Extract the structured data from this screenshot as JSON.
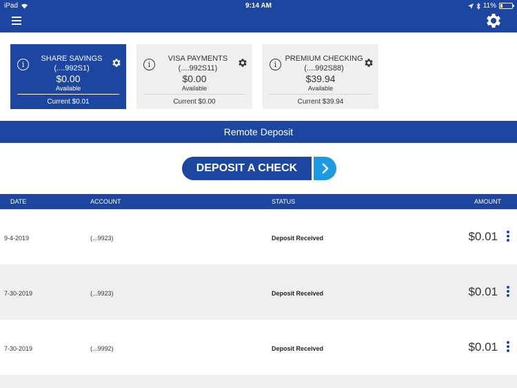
{
  "status_bar": {
    "device": "iPad",
    "time": "9:14 AM",
    "battery": "11%"
  },
  "header": {
    "menu_icon": "hamburger-icon",
    "settings_icon": "gear-icon"
  },
  "accounts": [
    {
      "name": "SHARE SAVINGS",
      "number": "(....992S1)",
      "available": "$0.00",
      "available_label": "Available",
      "current": "Current $0.01",
      "selected": true
    },
    {
      "name": "VISA PAYMENTS",
      "number": "(....992S11)",
      "available": "$0.00",
      "available_label": "Available",
      "current": "Current $0.00",
      "selected": false
    },
    {
      "name": "PREMIUM CHECKING",
      "number": "(....992S88)",
      "available": "$39.94",
      "available_label": "Available",
      "current": "Current $39.94",
      "selected": false
    }
  ],
  "section_title": "Remote Deposit",
  "deposit_button": {
    "label": "DEPOSIT A CHECK"
  },
  "table": {
    "columns": {
      "date": "DATE",
      "account": "ACCOUNT",
      "status": "STATUS",
      "amount": "AMOUNT"
    },
    "rows": [
      {
        "date": "9-4-2019",
        "account": "(...9923)",
        "status": "Deposit Received",
        "amount": "$0.01"
      },
      {
        "date": "7-30-2019",
        "account": "(...9923)",
        "status": "Deposit Received",
        "amount": "$0.01"
      },
      {
        "date": "7-30-2019",
        "account": "(...9992)",
        "status": "Deposit Received",
        "amount": "$0.01"
      }
    ]
  },
  "colors": {
    "primary": "#1d46a0",
    "accent": "#1e9ae0",
    "card_bg": "#efefef"
  }
}
